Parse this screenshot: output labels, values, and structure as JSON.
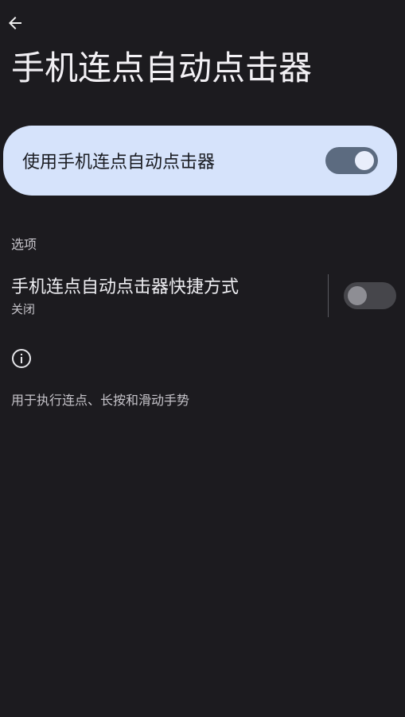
{
  "header": {
    "back_icon": "arrow-left-icon",
    "title": "手机连点自动点击器"
  },
  "main_toggle": {
    "label": "使用手机连点自动点击器",
    "enabled": true,
    "color_on_track": "#5c6b80",
    "color_card": "#d6e3fb"
  },
  "options_section": {
    "header": "选项",
    "shortcut": {
      "title": "手机连点自动点击器快捷方式",
      "status": "关闭",
      "enabled": false
    }
  },
  "info": {
    "icon": "info-icon",
    "text": "用于执行连点、长按和滑动手势"
  }
}
